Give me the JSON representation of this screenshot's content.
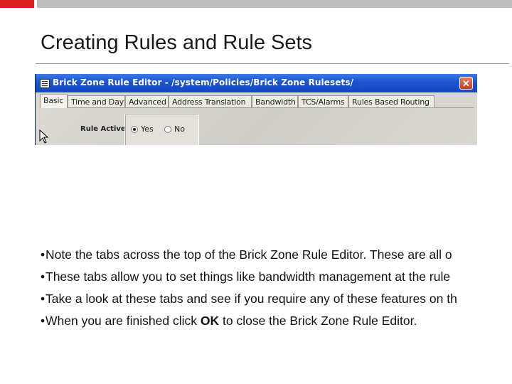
{
  "slide": {
    "title": "Creating Rules and Rule Sets"
  },
  "dialog": {
    "window_title": "Brick Zone Rule Editor - /system/Policies/Brick Zone Rulesets/",
    "close_glyph": "✕",
    "tabs": [
      {
        "label": "Basic",
        "active": true
      },
      {
        "label": "Time and Day",
        "active": false
      },
      {
        "label": "Advanced",
        "active": false
      },
      {
        "label": "Address Translation",
        "active": false
      },
      {
        "label": "Bandwidth",
        "active": false
      },
      {
        "label": "TCS/Alarms",
        "active": false
      },
      {
        "label": "Rules Based Routing",
        "active": false
      }
    ],
    "rule_active": {
      "label": "Rule Active",
      "options": [
        "Yes",
        "No"
      ],
      "selected": "Yes"
    }
  },
  "bullets": [
    {
      "text": "Note the tabs across the top of the Brick Zone Rule Editor. These are all o"
    },
    {
      "text": "These tabs allow you to set things like bandwidth management at the rule"
    },
    {
      "text": "Take a look at these tabs and see if you require any of these features on th"
    },
    {
      "before": "When you are finished click ",
      "bold": "OK",
      "after": " to close the Brick Zone Rule Editor."
    }
  ],
  "bullet_char": "•",
  "colors": {
    "accent_red": "#d9201e",
    "titlebar_blue": "#1e56d0"
  }
}
